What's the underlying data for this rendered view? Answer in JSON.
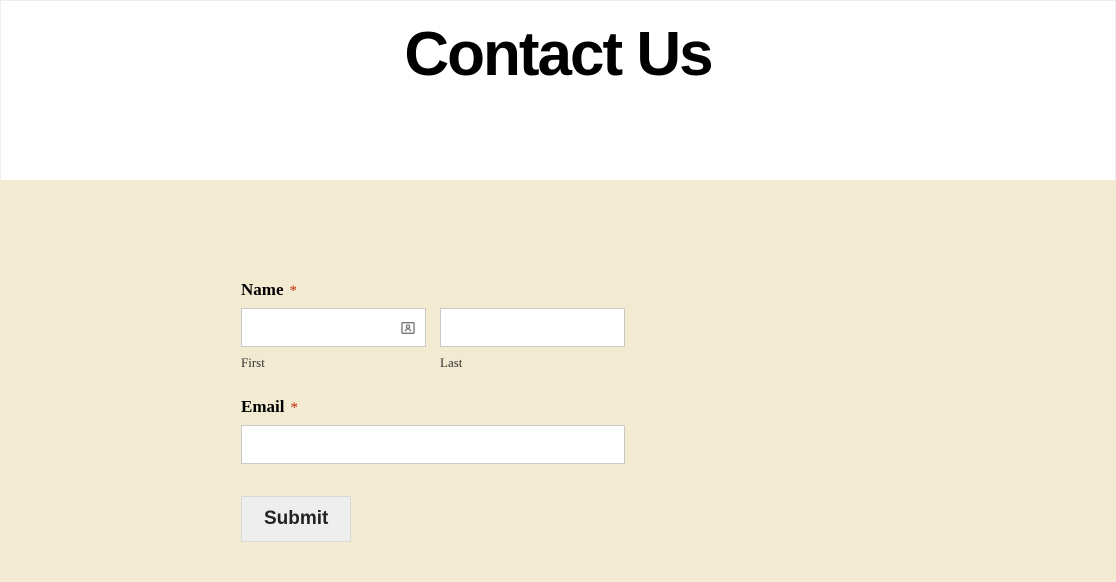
{
  "header": {
    "title": "Contact Us"
  },
  "form": {
    "name": {
      "label": "Name",
      "required_marker": "*",
      "first": {
        "value": "",
        "sublabel": "First"
      },
      "last": {
        "value": "",
        "sublabel": "Last"
      }
    },
    "email": {
      "label": "Email",
      "required_marker": "*",
      "value": ""
    },
    "submit_label": "Submit"
  },
  "colors": {
    "form_background": "#f3ead2",
    "required_star": "#c02b0a"
  }
}
